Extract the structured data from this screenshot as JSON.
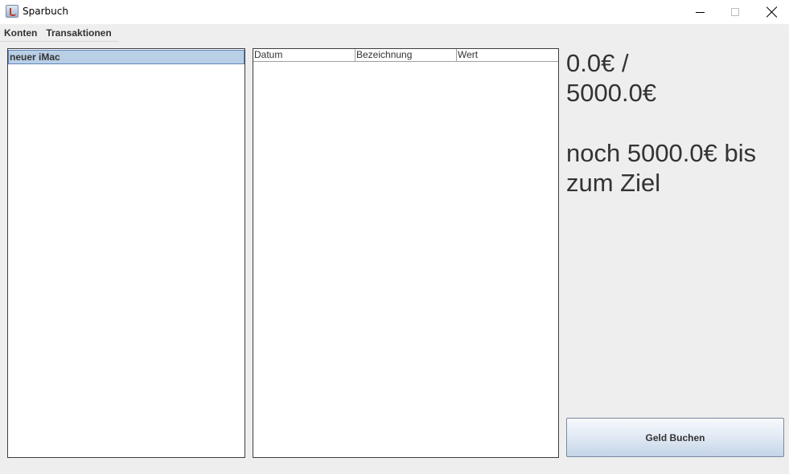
{
  "window": {
    "title": "Sparbuch",
    "icon": "java-cup-icon",
    "controls": [
      "minimize-icon",
      "maximize-icon",
      "close-icon"
    ]
  },
  "menu": {
    "items": [
      {
        "label": "Konten"
      },
      {
        "label": "Transaktionen"
      }
    ]
  },
  "accounts": {
    "items": [
      {
        "label": "neuer iMac",
        "selected": true
      }
    ]
  },
  "transactions": {
    "columns": [
      "Datum",
      "Bezeichnung",
      "Wert"
    ],
    "rows": []
  },
  "summary": {
    "progress_line1": "0.0€ /",
    "progress_line2": "5000.0€",
    "remaining_line1": "noch 5000.0€ bis",
    "remaining_line2": "zum Ziel"
  },
  "actions": {
    "book_label": "Geld Buchen"
  },
  "colors": {
    "selection": "#b8cfe5",
    "background": "#eeeeee"
  }
}
